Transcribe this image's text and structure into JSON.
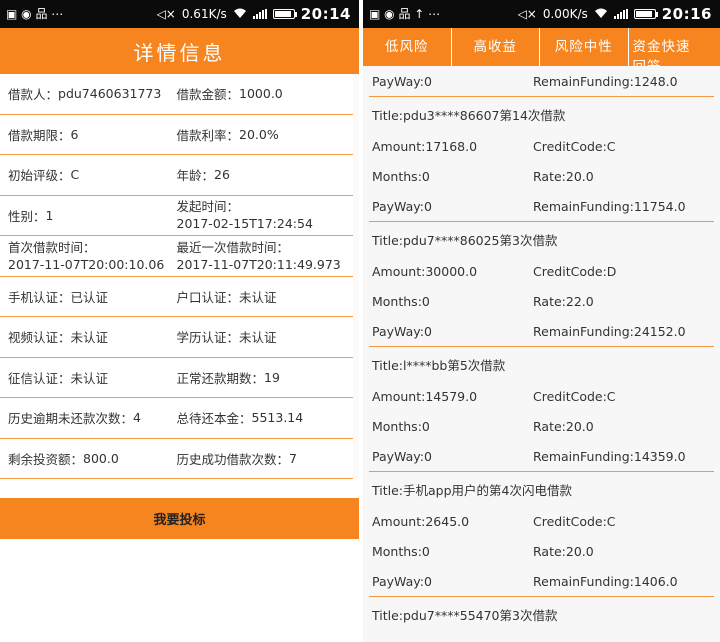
{
  "left": {
    "status": {
      "time": "20:14",
      "net": "0.61K/s",
      "left_glyphs": "▣ ◉ 品 ⋯"
    },
    "title": "详情信息",
    "rows": [
      {
        "l": {
          "k": "借款人：",
          "v": "pdu7460631773"
        },
        "r": {
          "k": "借款金额：",
          "v": "1000.0"
        }
      },
      {
        "l": {
          "k": "借款期限：",
          "v": "6"
        },
        "r": {
          "k": "借款利率：",
          "v": "20.0%"
        }
      },
      {
        "l": {
          "k": "初始评级：",
          "v": "C"
        },
        "r": {
          "k": "年龄：",
          "v": "26"
        }
      },
      {
        "l": {
          "k": "性别：",
          "v": "1"
        },
        "r": {
          "k": "发起时间：",
          "v": "2017-02-15T17:24:54"
        },
        "r_two": true
      },
      {
        "l": {
          "k": "首次借款时间：",
          "v": "2017-11-07T20:00:10.06"
        },
        "l_two": true,
        "r": {
          "k": "最近一次借款时间：",
          "v": "2017-11-07T20:11:49.973"
        },
        "r_two": true
      },
      {
        "l": {
          "k": "手机认证：",
          "v": "已认证"
        },
        "r": {
          "k": "户口认证：",
          "v": "未认证"
        }
      },
      {
        "l": {
          "k": "视频认证：",
          "v": "未认证"
        },
        "r": {
          "k": "学历认证：",
          "v": "未认证"
        }
      },
      {
        "l": {
          "k": "征信认证：",
          "v": "未认证"
        },
        "r": {
          "k": "正常还款期数：",
          "v": "19"
        }
      },
      {
        "l": {
          "k": "历史逾期未还款次数：",
          "v": "4"
        },
        "r": {
          "k": "总待还本金：",
          "v": "5513.14"
        }
      },
      {
        "l": {
          "k": "剩余投资额：",
          "v": "800.0"
        },
        "r": {
          "k": "历史成功借款次数：",
          "v": "7"
        }
      }
    ],
    "bid_button": "我要投标"
  },
  "right": {
    "status": {
      "time": "20:16",
      "net": "0.00K/s",
      "left_glyphs": "▣ ◉ 品 ↑ ⋯"
    },
    "tabs": [
      "低风险",
      "高收益",
      "风险中性",
      "资金快速回笼"
    ],
    "top_partial": {
      "payway": "PayWay:0",
      "remain": "RemainFunding:1248.0"
    },
    "loans": [
      {
        "title": "Title:pdu3****86607第14次借款",
        "amount": "Amount:17168.0",
        "credit": "CreditCode:C",
        "months": "Months:0",
        "rate": "Rate:20.0",
        "payway": "PayWay:0",
        "remain": "RemainFunding:11754.0"
      },
      {
        "title": "Title:pdu7****86025第3次借款",
        "amount": "Amount:30000.0",
        "credit": "CreditCode:D",
        "months": "Months:0",
        "rate": "Rate:22.0",
        "payway": "PayWay:0",
        "remain": "RemainFunding:24152.0"
      },
      {
        "title": "Title:l****bb第5次借款",
        "amount": "Amount:14579.0",
        "credit": "CreditCode:C",
        "months": "Months:0",
        "rate": "Rate:20.0",
        "payway": "PayWay:0",
        "remain": "RemainFunding:14359.0"
      },
      {
        "title": "Title:手机app用户的第4次闪电借款",
        "amount": "Amount:2645.0",
        "credit": "CreditCode:C",
        "months": "Months:0",
        "rate": "Rate:20.0",
        "payway": "PayWay:0",
        "remain": "RemainFunding:1406.0"
      }
    ],
    "last_title": "Title:pdu7****55470第3次借款"
  },
  "colors": {
    "accent": "#f7851f",
    "separator": "#f39a40",
    "statusbar": "#0b0b0b"
  },
  "icons": [
    "wifi-icon",
    "mute-icon",
    "signal-icon",
    "battery-icon"
  ]
}
